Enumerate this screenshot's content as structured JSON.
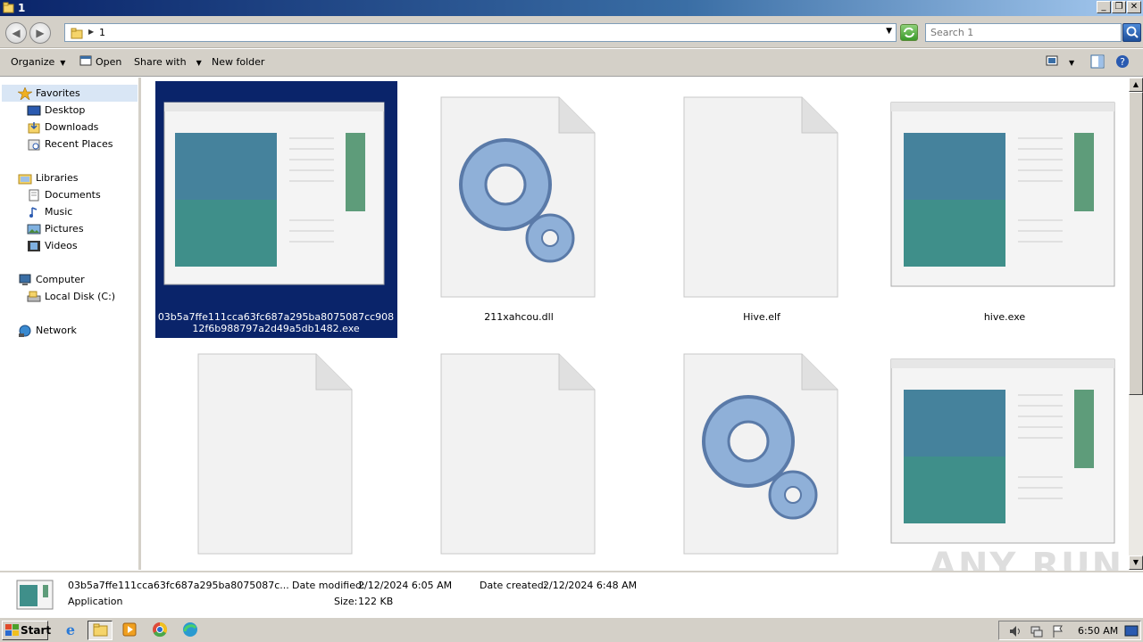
{
  "window": {
    "title": "1"
  },
  "address": {
    "path": "1",
    "search_placeholder": "Search 1"
  },
  "toolbar": {
    "organize": "Organize",
    "open": "Open",
    "share_with": "Share with",
    "new_folder": "New folder"
  },
  "nav": {
    "favorites": "Favorites",
    "desktop": "Desktop",
    "downloads": "Downloads",
    "recent_places": "Recent Places",
    "libraries": "Libraries",
    "documents": "Documents",
    "music": "Music",
    "pictures": "Pictures",
    "videos": "Videos",
    "computer": "Computer",
    "local_disk": "Local Disk (C:)",
    "network": "Network"
  },
  "files": [
    {
      "name": "03b5a7ffe111cca63fc687a295ba8075087cc90812f6b988797a2d49a5db1482.exe",
      "icon": "application-window-icon",
      "selected": true
    },
    {
      "name": "211xahcou.dll",
      "icon": "gears-icon"
    },
    {
      "name": "Hive.elf",
      "icon": "blank-file-icon"
    },
    {
      "name": "hive.exe",
      "icon": "application-window-icon"
    },
    {
      "name": "",
      "icon": "blank-file-icon"
    },
    {
      "name": "",
      "icon": "blank-file-icon"
    },
    {
      "name": "",
      "icon": "gears-icon"
    },
    {
      "name": "",
      "icon": "application-window-icon"
    }
  ],
  "details": {
    "name": "03b5a7ffe111cca63fc687a295ba8075087c...",
    "type": "Application",
    "date_modified_label": "Date modified:",
    "date_modified": "2/12/2024 6:05 AM",
    "date_created_label": "Date created:",
    "date_created": "2/12/2024 6:48 AM",
    "size_label": "Size:",
    "size": "122 KB"
  },
  "taskbar": {
    "start": "Start",
    "clock": "6:50 AM"
  },
  "watermark": "ANY RUN",
  "colors": {
    "selection": "#0a246a",
    "chrome": "#d4d0c8",
    "titlebar": "#0a246a"
  }
}
